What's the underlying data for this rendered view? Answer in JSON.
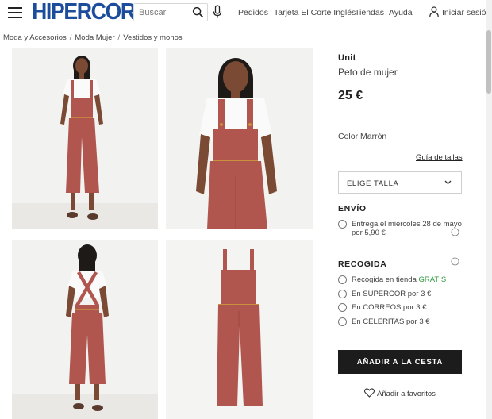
{
  "header": {
    "logo": "HIPERCOR",
    "search": {
      "placeholder": "Buscar"
    },
    "nav": [
      "Pedidos",
      "Tarjeta El Corte Inglés",
      "Tiendas",
      "Ayuda"
    ],
    "login_label": "Iniciar sesión",
    "brand_color": "#1c4d9c"
  },
  "breadcrumb": [
    "Moda y Accesorios",
    "Moda Mujer",
    "Vestidos y monos"
  ],
  "product": {
    "brand": "Unit",
    "name": "Peto de mujer",
    "price": "25 €",
    "color_label": "Color Marrón",
    "size_guide": "Guía de tallas",
    "size_select": "ELIGE TALLA",
    "garment_color": "#b0564e",
    "shipping": {
      "title": "ENVÍO",
      "line1": "Entrega el miércoles 28 de mayo",
      "line2": "por 5,90 €"
    },
    "pickup": {
      "title": "RECOGIDA",
      "options": [
        {
          "text": "Recogida en tienda",
          "highlight": "GRATIS"
        },
        {
          "text": "En SUPERCOR por 3 €"
        },
        {
          "text": "En CORREOS por 3 €"
        },
        {
          "text": "En CELERITAS por 3 €"
        }
      ]
    },
    "add_to_cart": "AÑADIR A LA CESTA",
    "favorites": "Añadir a favoritos"
  },
  "gallery": [
    {
      "icon": "model-front-photo"
    },
    {
      "icon": "model-closeup-photo"
    },
    {
      "icon": "model-back-photo"
    },
    {
      "icon": "product-flat-photo"
    }
  ]
}
